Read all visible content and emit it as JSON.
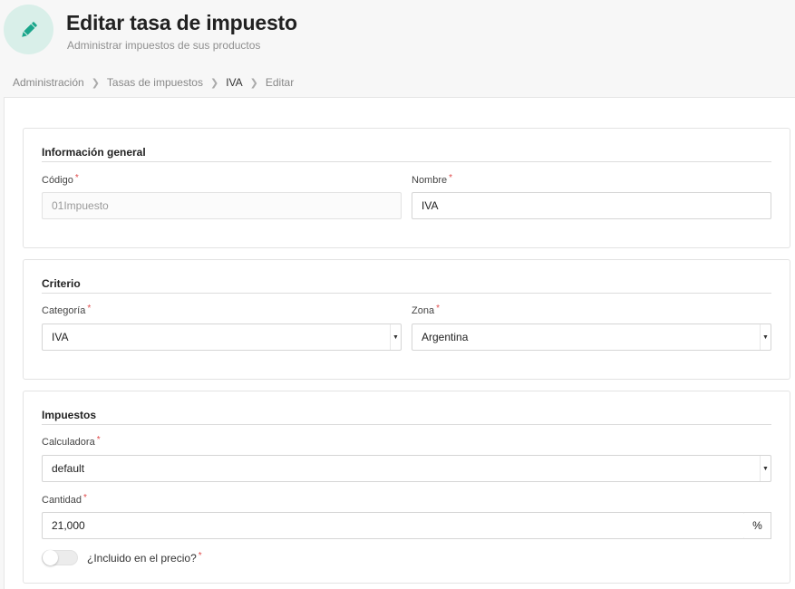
{
  "header": {
    "title": "Editar tasa de impuesto",
    "subtitle": "Administrar impuestos de sus productos",
    "icon": "pencil-icon",
    "icon_color": "#1aa68b",
    "icon_bg": "#d9efe9"
  },
  "breadcrumb": {
    "items": [
      "Administración",
      "Tasas de impuestos",
      "IVA",
      "Editar"
    ]
  },
  "general": {
    "title": "Información general",
    "code_label": "Código",
    "code_value": "01Impuesto",
    "name_label": "Nombre",
    "name_value": "IVA"
  },
  "criteria": {
    "title": "Criterio",
    "category_label": "Categoría",
    "category_value": "IVA",
    "zone_label": "Zona",
    "zone_value": "Argentina"
  },
  "taxes": {
    "title": "Impuestos",
    "calculator_label": "Calculadora",
    "calculator_value": "default",
    "amount_label": "Cantidad",
    "amount_value": "21,000",
    "amount_unit": "%",
    "included_label": "¿Incluido en el precio?",
    "included": false
  },
  "required_marker": "*",
  "colors": {
    "required": "#e04b4b",
    "accent": "#1aa68b"
  }
}
